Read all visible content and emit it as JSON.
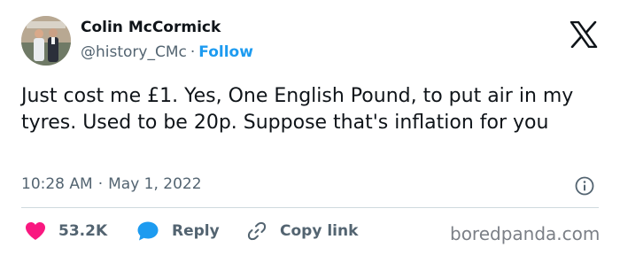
{
  "author": {
    "name": "Colin McCormick",
    "handle": "@history_CMc",
    "separator": "·",
    "follow_label": "Follow"
  },
  "tweet": {
    "text": "Just cost me £1. Yes, One English Pound, to put air in my tyres. Used to be 20p. Suppose that's inflation for you",
    "time": "10:28 AM",
    "separator": "·",
    "date": "May 1, 2022"
  },
  "actions": {
    "likes": "53.2K",
    "reply_label": "Reply",
    "copy_label": "Copy link"
  },
  "watermark": "boredpanda.com",
  "colors": {
    "like": "#f91880",
    "reply": "#1d9bf0",
    "follow": "#1d9bf0",
    "muted": "#536471"
  },
  "icons": [
    "x-logo-icon",
    "info-icon",
    "heart-icon",
    "speech-bubble-icon",
    "link-icon"
  ]
}
